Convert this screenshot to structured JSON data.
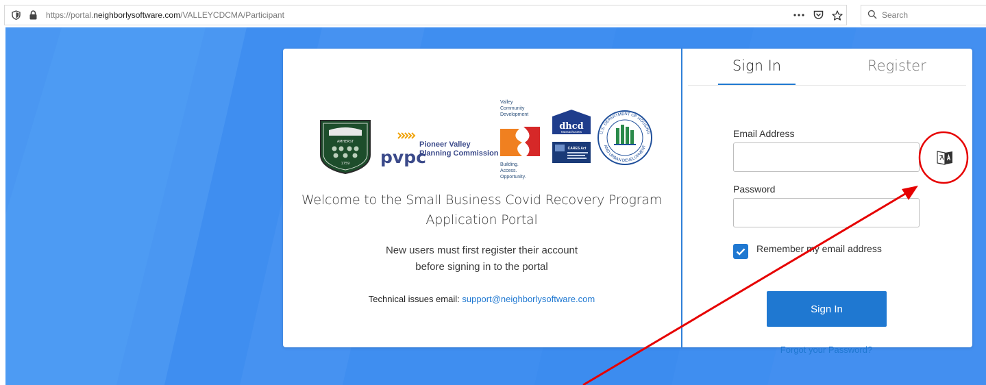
{
  "browser": {
    "url_prefix": "https://portal.",
    "url_host": "neighborlysoftware.com",
    "url_path": "/VALLEYCDCMA/Participant",
    "search_placeholder": "Search",
    "icons": [
      "shield-icon",
      "lock-icon",
      "more-icon",
      "pocket-icon",
      "bookmark-star-icon",
      "search-icon"
    ]
  },
  "logos": {
    "amherst": {
      "motto": "AMHERST",
      "year": "1759"
    },
    "pvpc": {
      "abbr": "pvpc",
      "name_line1": "Pioneer Valley",
      "name_line2": "Planning Commission"
    },
    "valley": {
      "name": [
        "Valley",
        "Community",
        "Development"
      ],
      "tagline": [
        "Building.",
        "Access.",
        "Opportunity."
      ]
    },
    "dhcd": {
      "abbr": "dhcd",
      "state": "Massachusetts"
    },
    "cares": {
      "title": "CARES Act"
    },
    "hud": {
      "ring_top": "U.S. DEPARTMENT OF HOUSING",
      "ring_bottom": "AND URBAN DEVELOPMENT"
    }
  },
  "welcome": {
    "line1": "Welcome to the Small Business Covid Recovery Program",
    "line2": "Application Portal",
    "new_users_1": "New users must first register their account",
    "new_users_2": "before signing in to the portal",
    "support_label": "Technical issues email:",
    "support_email": "support@neighborlysoftware.com"
  },
  "auth": {
    "tabs": [
      {
        "label": "Sign In",
        "active": true
      },
      {
        "label": "Register",
        "active": false
      }
    ],
    "email_label": "Email Address",
    "email_value": "",
    "password_label": "Password",
    "password_value": "",
    "remember_label": "Remember my email address",
    "remember_checked": true,
    "signin_label": "Sign In",
    "forgot_label": "Forgot your Password?",
    "translate_icon": "translate-icon"
  },
  "colors": {
    "page_bg": "#3f8ef0",
    "accent": "#1f78d1",
    "annotation": "#e60000"
  }
}
